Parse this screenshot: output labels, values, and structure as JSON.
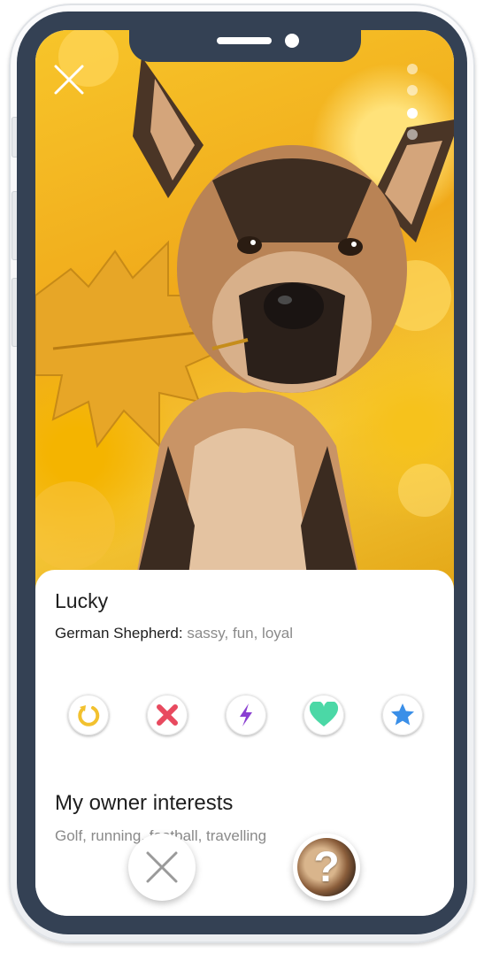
{
  "profile": {
    "name": "Lucky",
    "breed": "German Shepherd:",
    "traits": "sassy, fun, loyal"
  },
  "interests": {
    "title": "My owner interests",
    "text": "Golf, running, football, travelling"
  },
  "actions": [
    {
      "icon": "undo-icon",
      "color": "#f2c12e"
    },
    {
      "icon": "close-icon",
      "color": "#e84a5f"
    },
    {
      "icon": "lightning-icon",
      "color": "#8a3fd1"
    },
    {
      "icon": "heart-icon",
      "color": "#4bd8a6"
    },
    {
      "icon": "star-icon",
      "color": "#3a8fe8"
    }
  ],
  "help_button": {
    "label": "?"
  },
  "colors": {
    "bezel": "#344154",
    "photo_bg": "#f2b320"
  }
}
